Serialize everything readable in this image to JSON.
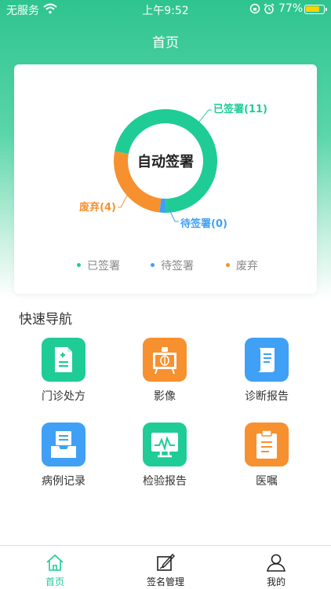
{
  "status_bar": {
    "carrier": "无服务",
    "time": "上午9:52",
    "battery": "77%"
  },
  "header": {
    "title": "首页"
  },
  "chart_data": {
    "type": "pie",
    "center_label": "自动签署",
    "categories": [
      "已签署",
      "待签署",
      "废弃"
    ],
    "values": [
      11,
      0,
      4
    ],
    "slice_labels": [
      "已签署(11)",
      "待签署(0)",
      "废弃(4)"
    ],
    "colors": [
      "#1fcc96",
      "#3fa0f5",
      "#f7902f"
    ],
    "legend_position": "bottom"
  },
  "quick_nav": {
    "title": "快速导航",
    "items": [
      {
        "label": "门诊处方",
        "icon": "prescription-icon",
        "color": "#1fcc96"
      },
      {
        "label": "影像",
        "icon": "imaging-icon",
        "color": "#f7902f"
      },
      {
        "label": "诊断报告",
        "icon": "report-scroll-icon",
        "color": "#3fa0f5"
      },
      {
        "label": "病例记录",
        "icon": "inbox-record-icon",
        "color": "#3fa0f5"
      },
      {
        "label": "检验报告",
        "icon": "monitor-chart-icon",
        "color": "#1fcc96"
      },
      {
        "label": "医嘱",
        "icon": "clipboard-icon",
        "color": "#f7902f"
      }
    ]
  },
  "tab_bar": {
    "active_color": "#1fcc96",
    "tabs": [
      {
        "label": "首页",
        "icon": "home-icon",
        "active": true
      },
      {
        "label": "签名管理",
        "icon": "sign-edit-icon",
        "active": false
      },
      {
        "label": "我的",
        "icon": "user-icon",
        "active": false
      }
    ]
  }
}
